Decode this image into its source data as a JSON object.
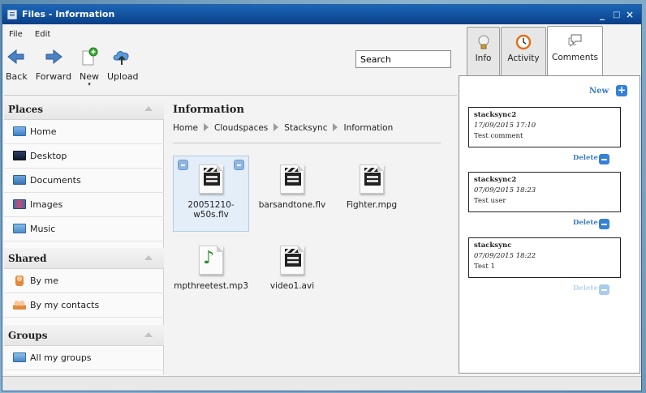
{
  "window": {
    "title": "Files - Information",
    "controls": [
      "_",
      "□",
      "×"
    ]
  },
  "menu": [
    "File",
    "Edit"
  ],
  "toolbar": {
    "back": "Back",
    "forward": "Forward",
    "new": "New",
    "upload": "Upload"
  },
  "search": {
    "value": "Search"
  },
  "sidebar": {
    "places": {
      "title": "Places",
      "items": [
        "Home",
        "Desktop",
        "Documents",
        "Images",
        "Music"
      ]
    },
    "shared": {
      "title": "Shared",
      "items": [
        "By me",
        "By my contacts"
      ]
    },
    "groups": {
      "title": "Groups",
      "items": [
        "All my groups"
      ]
    }
  },
  "main": {
    "title": "Information",
    "breadcrumb": [
      "Home",
      "Cloudspaces",
      "Stacksync",
      "Information"
    ],
    "files": [
      {
        "name_line1": "20051210-",
        "name_line2": "w50s.flv",
        "type": "video",
        "selected": true
      },
      {
        "name_line1": "barsandtone.flv",
        "type": "video"
      },
      {
        "name_line1": "Fighter.mpg",
        "type": "video"
      },
      {
        "name_line1": "mpthreetest.mp3",
        "type": "audio"
      },
      {
        "name_line1": "video1.avi",
        "type": "video"
      }
    ]
  },
  "tabs": {
    "info": "Info",
    "activity": "Activity",
    "comments": "Comments",
    "active": "comments"
  },
  "comments_panel": {
    "new_label": "New",
    "delete_label": "Delete",
    "items": [
      {
        "author": "stacksync2",
        "date": "17/09/2015 17:10",
        "text": "Test comment",
        "deletable": true
      },
      {
        "author": "stacksync2",
        "date": "07/09/2015 18:23",
        "text": "Test user",
        "deletable": true
      },
      {
        "author": "stacksync",
        "date": "07/09/2015 18:22",
        "text": "Test 1",
        "deletable": false
      }
    ]
  },
  "colors": {
    "titlebar": "#0a3f86",
    "accent": "#3581d8",
    "link": "#3a7cc9"
  }
}
